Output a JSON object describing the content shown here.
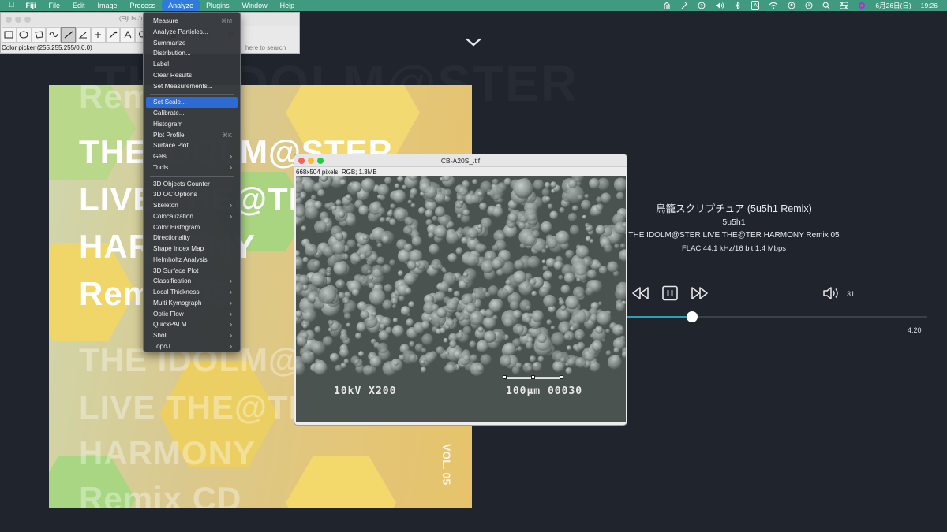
{
  "menubar": {
    "apple_icon": "apple-icon",
    "app_name": "Fiji",
    "items": [
      "File",
      "Edit",
      "Image",
      "Process",
      "Analyze",
      "Plugins",
      "Window",
      "Help"
    ],
    "active_item": "Analyze",
    "status_icons": [
      "fan-icon",
      "wand-icon",
      "help-circle-icon",
      "volume-icon",
      "bluetooth-icon",
      "input-a-icon",
      "wifi-icon",
      "user-icon",
      "clock-history-icon",
      "search-icon",
      "control-center-icon",
      "siri-icon"
    ],
    "input_letter": "A",
    "date": "6月26日(日)",
    "time": "19:26"
  },
  "fiji_toolbar": {
    "title": "(Fiji Is Just ImageJ)",
    "status": "Color picker (255,255,255/0,0,0)",
    "search_hint": "here to search",
    "tools": [
      "rectangle-tool-icon",
      "oval-tool-icon",
      "polygon-tool-icon",
      "freehand-tool-icon",
      "line-tool-icon",
      "angle-tool-icon",
      "point-tool-icon",
      "wand-tool-icon",
      "text-tool-icon",
      "magnifier-tool-icon",
      "scroll-tool-icon",
      "color-picker-tool-icon",
      "dropper-tool-icon",
      "more-tools-icon"
    ]
  },
  "analyze_menu": {
    "items": [
      {
        "label": "Measure",
        "shortcut": "⌘M"
      },
      {
        "label": "Analyze Particles..."
      },
      {
        "label": "Summarize"
      },
      {
        "label": "Distribution..."
      },
      {
        "label": "Label"
      },
      {
        "label": "Clear Results"
      },
      {
        "label": "Set Measurements..."
      },
      {
        "sep": true
      },
      {
        "label": "Set Scale...",
        "highlighted": true
      },
      {
        "label": "Calibrate..."
      },
      {
        "label": "Histogram"
      },
      {
        "label": "Plot Profile",
        "shortcut": "⌘K"
      },
      {
        "label": "Surface Plot..."
      },
      {
        "label": "Gels",
        "submenu": true
      },
      {
        "label": "Tools",
        "submenu": true
      },
      {
        "sep": true
      },
      {
        "label": "3D Objects Counter"
      },
      {
        "label": "3D OC Options"
      },
      {
        "label": "Skeleton",
        "submenu": true
      },
      {
        "label": "Colocalization",
        "submenu": true
      },
      {
        "label": "Color Histogram"
      },
      {
        "label": "Directionality"
      },
      {
        "label": "Shape Index Map"
      },
      {
        "label": "Helmholtz Analysis"
      },
      {
        "label": "3D Surface Plot"
      },
      {
        "label": "Classification",
        "submenu": true
      },
      {
        "label": "Local Thickness",
        "submenu": true
      },
      {
        "label": "Multi Kymograph",
        "submenu": true
      },
      {
        "label": "Optic Flow",
        "submenu": true
      },
      {
        "label": "QuickPALM",
        "submenu": true
      },
      {
        "label": "Sholl",
        "submenu": true
      },
      {
        "label": "TopoJ",
        "submenu": true
      }
    ]
  },
  "image_window": {
    "title": "CB-A20S_.tif",
    "info": "668x504 pixels; RGB; 1.3MB",
    "sem_left_text": "10kV X200",
    "sem_right_text": "100μm 00030"
  },
  "player": {
    "background_ghost": "THE IDOLM@STER",
    "track_title": "鳥籠スクリプチュア (5u5h1 Remix)",
    "artist": "5u5h1",
    "album": "THE IDOLM@STER LIVE THE@TER HARMONY Remix 05",
    "format": "FLAC 44.1 kHz/16 bit 1.4 Mbps",
    "volume": "31",
    "duration": "4:20",
    "progress_fraction": 0.22,
    "accent_color": "#2a9fb5",
    "album_art": {
      "title_lines": [
        "THE IDOLM@STER",
        "LIVE THE@TER",
        "HARMONY",
        "Remix 05"
      ],
      "ghost_top": "Remix",
      "ghost_lines": [
        "THE IDOLM@STER",
        "LIVE THE@TER",
        "HARMONY",
        "Remix CD"
      ],
      "vol_text": "VOL. 05"
    }
  }
}
